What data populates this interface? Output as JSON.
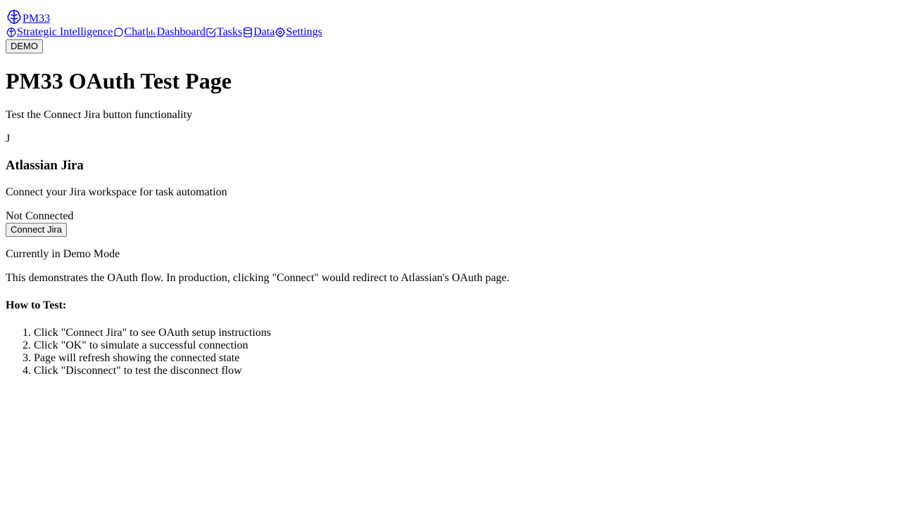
{
  "app": {
    "name": "PM33",
    "logo_icon": "brain-icon"
  },
  "nav": {
    "items": [
      {
        "label": "Strategic Intelligence",
        "icon": "brain-icon"
      },
      {
        "label": "Chat",
        "icon": "chat-bubble-icon"
      },
      {
        "label": "Dashboard",
        "icon": "bar-chart-icon"
      },
      {
        "label": "Tasks",
        "icon": "check-square-icon"
      },
      {
        "label": "Data",
        "icon": "database-icon"
      },
      {
        "label": "Settings",
        "icon": "gear-icon"
      }
    ],
    "demo_button": "DEMO"
  },
  "page": {
    "title": "PM33 OAuth Test Page",
    "subtitle": "Test the Connect Jira button functionality"
  },
  "integration": {
    "avatar_letter": "J",
    "name": "Atlassian Jira",
    "description": "Connect your Jira workspace for task automation",
    "status": "Not Connected",
    "connect_button": "Connect Jira"
  },
  "demo_notice": {
    "title": "Currently in Demo Mode",
    "text": "This demonstrates the OAuth flow. In production, clicking \"Connect\" would redirect to Atlassian's OAuth page."
  },
  "how_to": {
    "heading": "How to Test:",
    "steps": [
      "Click \"Connect Jira\" to see OAuth setup instructions",
      "Click \"OK\" to simulate a successful connection",
      "Page will refresh showing the connected state",
      "Click \"Disconnect\" to test the disconnect flow"
    ]
  }
}
